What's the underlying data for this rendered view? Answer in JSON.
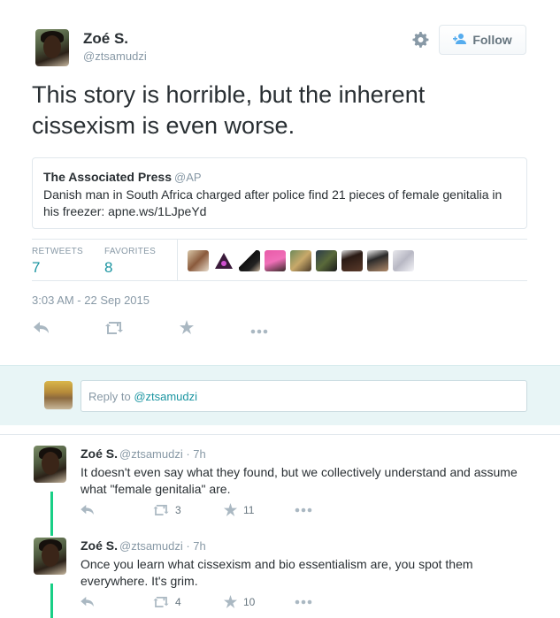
{
  "tweet": {
    "author_name": "Zoé S.",
    "author_handle": "@ztsamudzi",
    "follow_label": "Follow",
    "text": "This story is horrible, but the inherent cissexism is even worse.",
    "quote": {
      "name": "The Associated Press",
      "handle": "@AP",
      "text": "Danish man in South Africa charged after police find 21 pieces of female genitalia in his freezer: apne.ws/1LJpeYd"
    },
    "stats": {
      "retweets_label": "RETWEETS",
      "retweets_value": "7",
      "favorites_label": "FAVORITES",
      "favorites_value": "8"
    },
    "timestamp": "3:03 AM - 22 Sep 2015"
  },
  "reply_box": {
    "prefix": "Reply to ",
    "mention": "@ztsamudzi"
  },
  "replies": [
    {
      "name": "Zoé S.",
      "meta": "@ztsamudzi · 7h",
      "text": "It doesn't even say what they found, but we collectively understand and assume what \"female genitalia\" are.",
      "retweets": "3",
      "favorites": "11"
    },
    {
      "name": "Zoé S.",
      "meta": "@ztsamudzi · 7h",
      "text": "Once you learn what cissexism and bio essentialism are, you spot them everywhere. It's grim.",
      "retweets": "4",
      "favorites": "10"
    }
  ],
  "icons": {
    "settings": "gear-icon",
    "follow": "add-user-icon",
    "reply": "reply-icon",
    "retweet": "retweet-icon",
    "favorite": "star-icon",
    "more": "more-icon"
  },
  "colors": {
    "accent": "#1b95a1",
    "muted": "#8899a6",
    "thread": "#19cf86",
    "reply_bg": "#e8f5f6"
  }
}
